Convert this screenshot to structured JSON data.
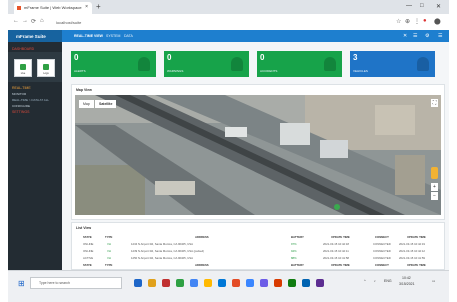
{
  "browser": {
    "tab_title": "mFrame Suite | Web Workspace",
    "new_tab": "+",
    "url": "localhost/suite",
    "window_controls": [
      "—",
      "□",
      "✕"
    ],
    "nav": [
      "←",
      "→",
      "⟳",
      "⌂"
    ],
    "extensions": [
      "☆",
      "⊕",
      "⋮",
      "●",
      "⬤"
    ]
  },
  "app": {
    "brand": "mFrame Suite",
    "menu": [
      "REAL-TIME VIEW",
      "SYSTEM",
      "DATA"
    ],
    "active_menu_index": 0,
    "top_icons": [
      "✕",
      "☰",
      "⚙",
      "☰"
    ]
  },
  "sidebar": {
    "heading": "DASHBOARD",
    "buttons": [
      "Live",
      "Logs"
    ],
    "section1": "REAL-TIME",
    "row1": "MONITOR",
    "section2": "REAL-TIME > DATA AT ALL",
    "row2": "CONFIGURE",
    "section3": "SETTINGS",
    "row3": "..."
  },
  "cards": [
    {
      "value": "0",
      "label": "ALERTS",
      "color": "#17a34a"
    },
    {
      "value": "0",
      "label": "WARNINGS",
      "color": "#17a34a"
    },
    {
      "value": "0",
      "label": "ACCIDENTS",
      "color": "#17a34a"
    },
    {
      "value": "3",
      "label": "VEHICLES",
      "color": "#1f74c7"
    }
  ],
  "map_panel": {
    "title": "Map View",
    "tabs": [
      "Map",
      "Satellite"
    ],
    "zoom_in": "+",
    "zoom_out": "−",
    "fullscreen": "⛶"
  },
  "list_panel": {
    "title": "List View",
    "columns": [
      "STATE",
      "TYPE",
      "ADDRESS",
      "BATTERY",
      "UPDATE TIME",
      "CONNECT",
      "UPDATE TIME"
    ],
    "rows": [
      {
        "state": "ONLINE",
        "type": "VH",
        "address": "1234 N Airport Rd, Santa Monica, CA 90405, USA",
        "battery": "97%",
        "time": "2021-03-15 10:42:18",
        "connect": "CONNECTED",
        "update": "2021-03-15 10:42:19"
      },
      {
        "state": "ONLINE",
        "type": "VH",
        "address": "1239 N Airport Rd, Santa Monica, CA 90405, USA (parked)",
        "battery": "94%",
        "time": "2021-03-15 10:42:11",
        "connect": "CONNECTED",
        "update": "2021-03-15 10:42:12"
      },
      {
        "state": "ACTIVE",
        "type": "VH",
        "address": "1250 N Airport Rd, Santa Monica, CA 90405, USA",
        "battery": "88%",
        "time": "2021-03-15 10:41:58",
        "connect": "CONNECTED",
        "update": "2021-03-15 10:41:59"
      }
    ],
    "footer": [
      "STATE",
      "TYPE",
      "ADDRESS",
      "BATTERY",
      "UPDATE TIME",
      "CONNECT",
      "UPDATE TIME"
    ]
  },
  "taskbar": {
    "search_placeholder": "Type here to search",
    "app_colors": [
      "#1e66c8",
      "#e0a11b",
      "#c03030",
      "#2ea043",
      "#4285f4",
      "#ffb900",
      "#0078d7",
      "#e34c26",
      "#3a86ff",
      "#6c5ce7",
      "#d83b01",
      "#107c10",
      "#0063b1",
      "#5c2d91"
    ],
    "time": "10:42",
    "date": "3/15/2021",
    "lang": "ENG"
  }
}
